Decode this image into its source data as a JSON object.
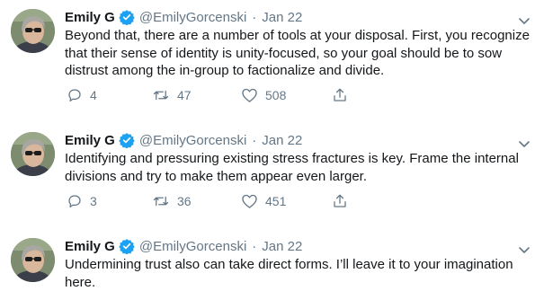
{
  "tweets": [
    {
      "author_name": "Emily G",
      "handle": "@EmilyGorcenski",
      "separator": "·",
      "date": "Jan 22",
      "text": "Beyond that, there are a number of tools at your disposal. First, you recognize that their sense of identity is unity-focused, so your goal should be to sow distrust among the in-group to factionalize and divide.",
      "reply_count": "4",
      "retweet_count": "47",
      "like_count": "508"
    },
    {
      "author_name": "Emily G",
      "handle": "@EmilyGorcenski",
      "separator": "·",
      "date": "Jan 22",
      "text": "Identifying and pressuring existing stress fractures is key. Frame the internal divisions and try to make them appear even larger.",
      "reply_count": "3",
      "retweet_count": "36",
      "like_count": "451"
    },
    {
      "author_name": "Emily G",
      "handle": "@EmilyGorcenski",
      "separator": "·",
      "date": "Jan 22",
      "text": "Undermining trust also can take direct forms. I’ll leave it to your imagination here.",
      "reply_count": "",
      "retweet_count": "",
      "like_count": ""
    }
  ],
  "icons": {
    "verified": "verified-badge-icon",
    "caret": "chevron-down-icon",
    "reply": "reply-icon",
    "retweet": "retweet-icon",
    "like": "heart-icon",
    "share": "share-icon"
  },
  "colors": {
    "text": "#14171a",
    "secondary": "#657786",
    "verified": "#1da1f2"
  }
}
